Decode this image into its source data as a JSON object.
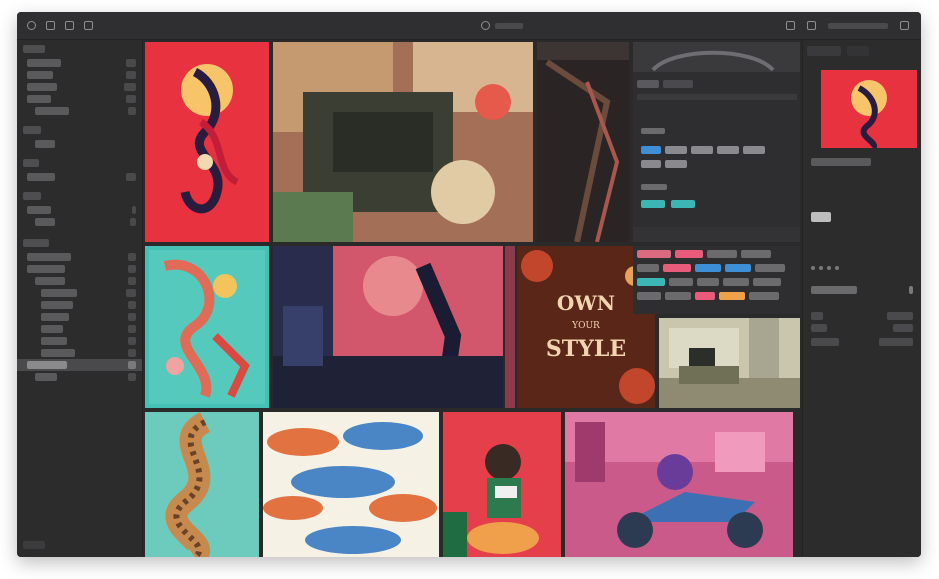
{
  "colors": {
    "window_bg": "#2a2a2b",
    "sidebar_bg": "#2c2c2d",
    "accent_blue": "#3d8fd6",
    "accent_red": "#e8404f",
    "tag_gray": "#6b6b6e",
    "tag_teal": "#3bb6b4",
    "tag_pink": "#e85b7a"
  },
  "sidebar": {
    "sections": [
      {
        "label": "",
        "items": [
          {
            "label": "",
            "count": ""
          },
          {
            "label": "",
            "count": ""
          },
          {
            "label": "",
            "count": ""
          },
          {
            "label": "",
            "count": ""
          },
          {
            "label": "",
            "count": ""
          }
        ]
      },
      {
        "label": "",
        "items": [
          {
            "label": "",
            "count": ""
          }
        ]
      },
      {
        "label": "",
        "items": [
          {
            "label": "",
            "count": ""
          }
        ]
      },
      {
        "label": "",
        "items": [
          {
            "label": "",
            "count": ""
          },
          {
            "label": "",
            "count": ""
          }
        ]
      },
      {
        "label": "",
        "items": [
          {
            "label": "",
            "count": ""
          },
          {
            "label": "",
            "count": ""
          },
          {
            "label": "",
            "count": ""
          },
          {
            "label": "",
            "count": ""
          },
          {
            "label": "",
            "count": ""
          },
          {
            "label": "",
            "count": ""
          },
          {
            "label": "",
            "count": ""
          },
          {
            "label": "",
            "count": ""
          },
          {
            "label": "",
            "count": ""
          },
          {
            "label": "",
            "count": ""
          },
          {
            "label": "",
            "count": ""
          }
        ]
      }
    ]
  },
  "tiles": [
    {
      "name": "tile-red-dragon-poster",
      "kind": "illustration"
    },
    {
      "name": "tile-collage-photo",
      "kind": "illustration"
    },
    {
      "name": "tile-dark-figure",
      "kind": "illustration"
    },
    {
      "name": "tile-ui-tags-panel",
      "kind": "ui"
    },
    {
      "name": "tile-teal-figure",
      "kind": "illustration"
    },
    {
      "name": "tile-navy-figure",
      "kind": "illustration"
    },
    {
      "name": "tile-pink-foliage",
      "kind": "illustration"
    },
    {
      "name": "tile-own-your-style",
      "kind": "illustration",
      "text": "OWN YOUR STYLE"
    },
    {
      "name": "tile-living-room-photo",
      "kind": "photo"
    },
    {
      "name": "tile-serpent",
      "kind": "illustration"
    },
    {
      "name": "tile-fish-pattern",
      "kind": "illustration"
    },
    {
      "name": "tile-girl-red",
      "kind": "illustration"
    },
    {
      "name": "tile-motorcycle-scene",
      "kind": "illustration"
    }
  ],
  "inspector": {
    "tabs": [
      "",
      ""
    ]
  }
}
